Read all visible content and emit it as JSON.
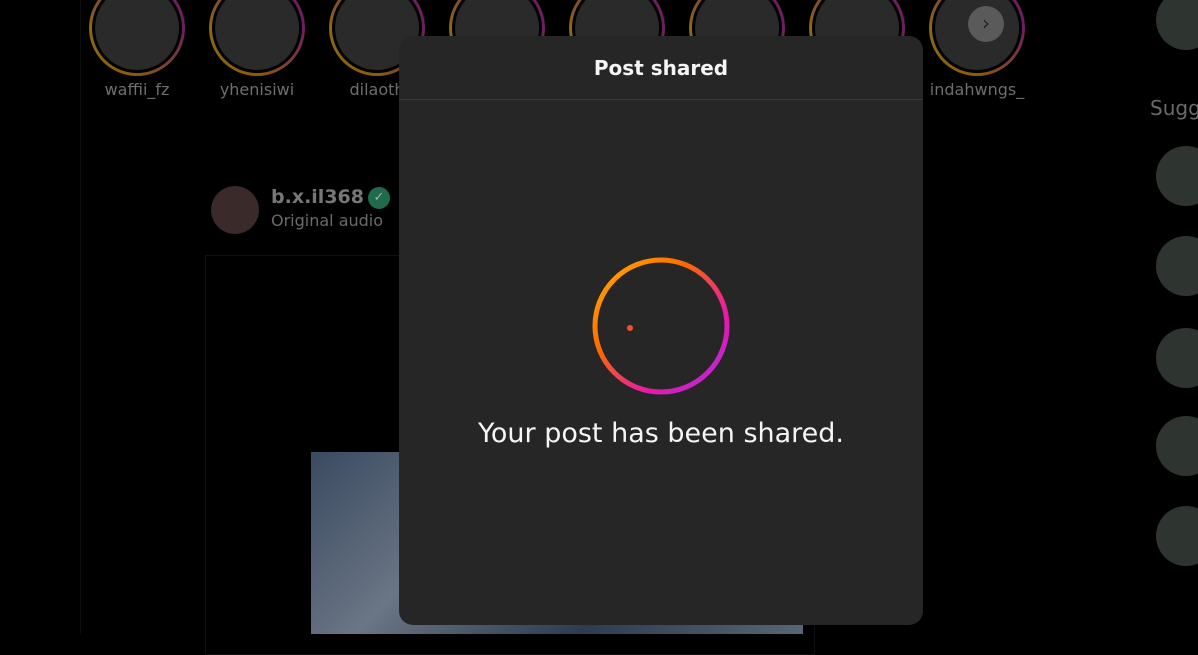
{
  "stories": [
    {
      "username": "waffii_fz"
    },
    {
      "username": "yhenisiwi"
    },
    {
      "username": "dilaoth"
    },
    {
      "username": ""
    },
    {
      "username": ""
    },
    {
      "username": ""
    },
    {
      "username": ""
    },
    {
      "username": "indahwngs_"
    }
  ],
  "post": {
    "username": "b.x.il368",
    "subtitle": "Original audio"
  },
  "sidebar": {
    "suggested_heading": "Sugg"
  },
  "modal": {
    "title": "Post shared",
    "message": "Your post has been shared.",
    "gradient_colors": [
      "#ffb200",
      "#ff6a00",
      "#e619a8",
      "#a82fe6"
    ]
  }
}
